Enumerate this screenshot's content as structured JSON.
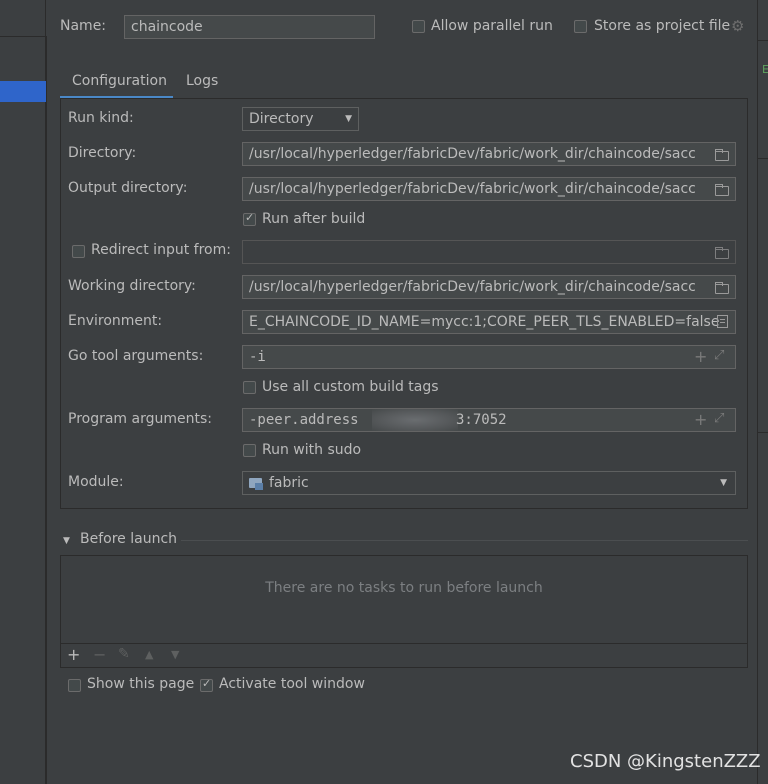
{
  "header": {
    "name_label": "Name:",
    "name_value": "chaincode",
    "allow_parallel_run": "Allow parallel run",
    "store_as_project_file": "Store as project file"
  },
  "tabs": [
    {
      "label": "Configuration",
      "active": true
    },
    {
      "label": "Logs",
      "active": false
    }
  ],
  "form": {
    "run_kind_label": "Run kind:",
    "run_kind_value": "Directory",
    "directory_label": "Directory:",
    "directory_value": "/usr/local/hyperledger/fabricDev/fabric/work_dir/chaincode/sacc",
    "output_directory_label": "Output directory:",
    "output_directory_value": "/usr/local/hyperledger/fabricDev/fabric/work_dir/chaincode/sacc",
    "run_after_build_label": "Run after build",
    "run_after_build_checked": true,
    "redirect_input_label": "Redirect input from:",
    "redirect_input_value": "",
    "working_directory_label": "Working directory:",
    "working_directory_value": "/usr/local/hyperledger/fabricDev/fabric/work_dir/chaincode/sacc",
    "environment_label": "Environment:",
    "environment_value": "E_CHAINCODE_ID_NAME=mycc:1;CORE_PEER_TLS_ENABLED=false",
    "go_tool_args_label": "Go tool arguments:",
    "go_tool_args_value": "-i",
    "use_custom_build_tags_label": "Use all custom build tags",
    "program_args_label": "Program arguments:",
    "program_args_prefix": "-peer.address",
    "program_args_suffix": "3:7052",
    "run_with_sudo_label": "Run with sudo",
    "module_label": "Module:",
    "module_value": "fabric"
  },
  "before_launch": {
    "title": "Before launch",
    "empty_text": "There are no tasks to run before launch"
  },
  "footer": {
    "show_this_page": "Show this page",
    "activate_tool_window": "Activate tool window",
    "activate_checked": true
  },
  "watermark": "CSDN @KingstenZZZ",
  "colors": {
    "background": "#3c3f41",
    "field_bg": "#45494a",
    "accent": "#4a88c7",
    "selection": "#2f65ca"
  }
}
